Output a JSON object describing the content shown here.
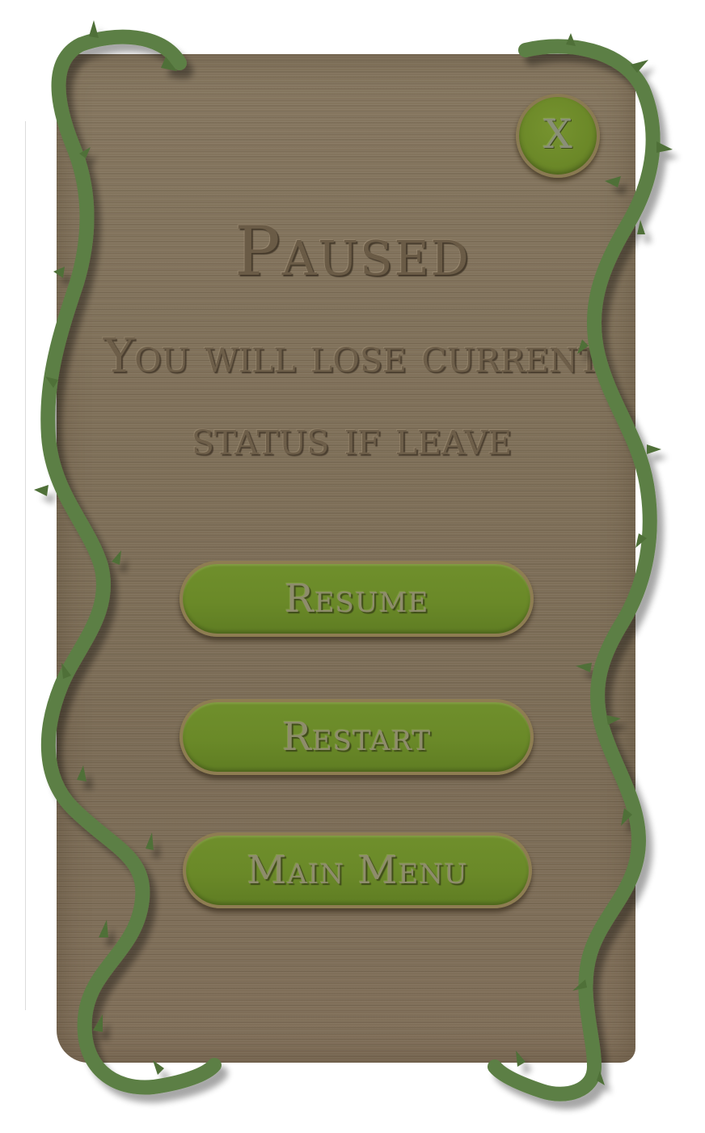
{
  "dialog": {
    "title": "Paused",
    "message_line1": "You will lose current",
    "message_line2": "status if leave",
    "close_label": "X"
  },
  "buttons": {
    "resume": "Resume",
    "restart": "Restart",
    "main_menu": "Main Menu"
  },
  "colors": {
    "panel_wood": "#7f7059",
    "button_green": "#6a8928",
    "vine_green": "#5c7f44",
    "text_engraved": "#6a5b46"
  },
  "icons": {
    "close": "close-icon"
  }
}
